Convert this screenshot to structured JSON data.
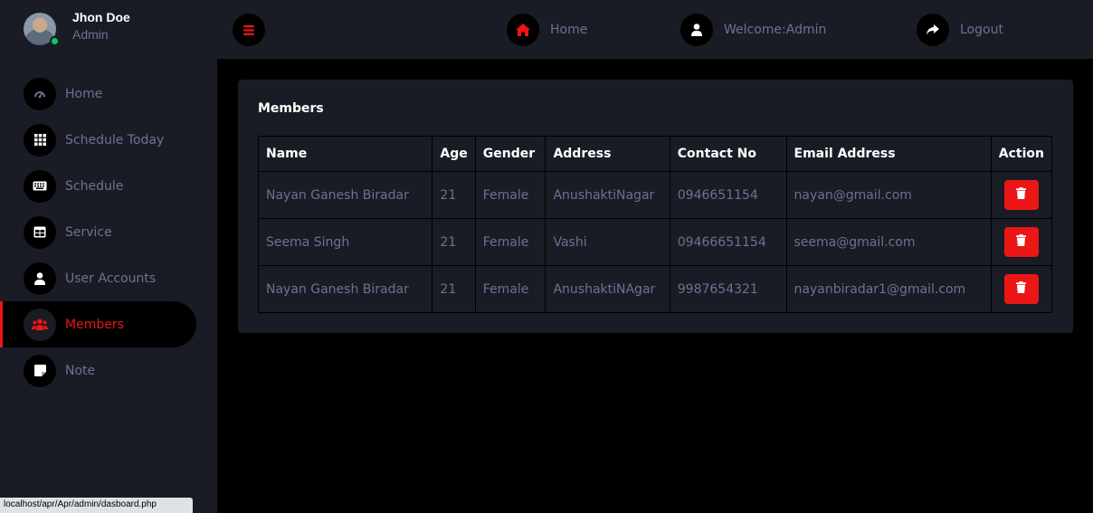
{
  "profile": {
    "name": "Jhon Doe",
    "role": "Admin"
  },
  "sidebar": {
    "items": [
      {
        "label": "Home",
        "icon": "dashboard-icon"
      },
      {
        "label": "Schedule Today",
        "icon": "grid-icon"
      },
      {
        "label": "Schedule",
        "icon": "keyboard-icon"
      },
      {
        "label": "Service",
        "icon": "table-icon"
      },
      {
        "label": "User Accounts",
        "icon": "user-icon"
      },
      {
        "label": "Members",
        "icon": "users-icon",
        "active": true
      },
      {
        "label": "Note",
        "icon": "note-icon"
      }
    ]
  },
  "topbar": {
    "menu_icon": "bars-icon",
    "home_label": "Home",
    "welcome_label": "Welcome:Admin",
    "logout_label": "Logout"
  },
  "members": {
    "title": "Members",
    "columns": [
      "Name",
      "Age",
      "Gender",
      "Address",
      "Contact No",
      "Email Address",
      "Action"
    ],
    "rows": [
      {
        "name": "Nayan Ganesh Biradar",
        "age": "21",
        "gender": "Female",
        "address": "AnushaktiNagar",
        "contact": "0946651154",
        "email": "nayan@gmail.com"
      },
      {
        "name": "Seema Singh",
        "age": "21",
        "gender": "Female",
        "address": "Vashi",
        "contact": "09466651154",
        "email": "seema@gmail.com"
      },
      {
        "name": "Nayan Ganesh Biradar",
        "age": "21",
        "gender": "Female",
        "address": "AnushaktiNAgar",
        "contact": "9987654321",
        "email": "nayanbiradar1@gmail.com"
      }
    ]
  },
  "status_bar": {
    "url": "localhost/apr/Apr/admin/dasboard.php"
  },
  "colors": {
    "accent": "#eb1616",
    "panel": "#191c24",
    "muted_text": "#6c7293",
    "background": "#000000",
    "online": "#00d25b"
  }
}
